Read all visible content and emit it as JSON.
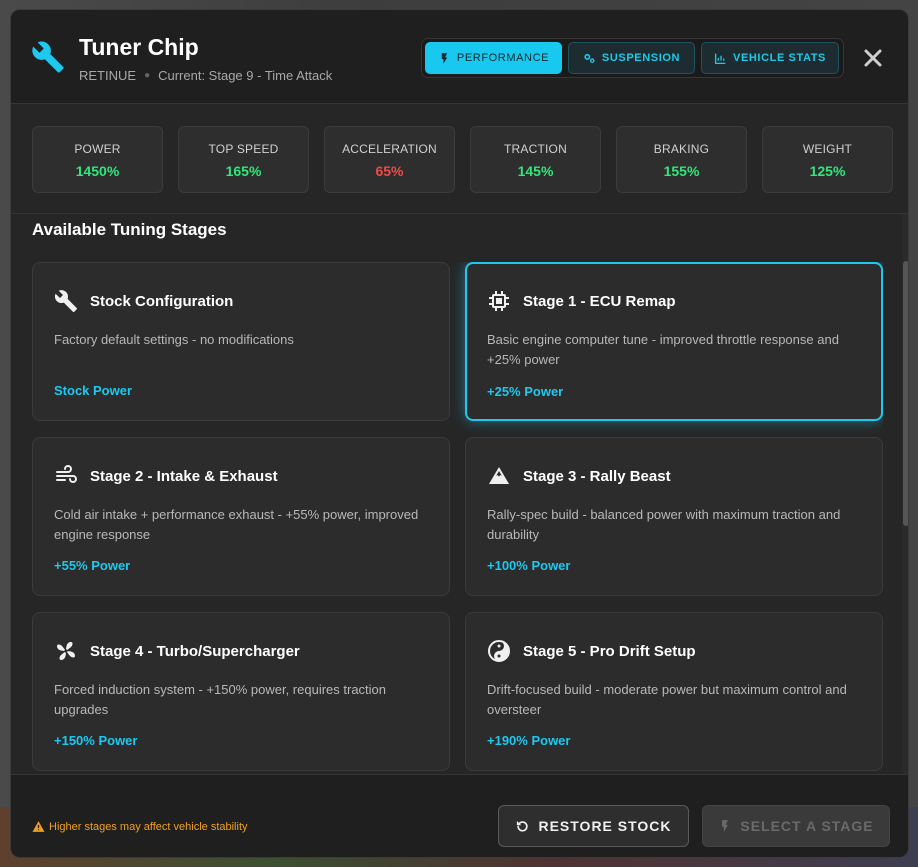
{
  "header": {
    "title": "Tuner Chip",
    "vehicle": "RETINUE",
    "current": "Current: Stage 9 - Time Attack",
    "tabs": [
      {
        "label": "PERFORMANCE",
        "icon": "bolt-icon",
        "active": true
      },
      {
        "label": "SUSPENSION",
        "icon": "gears-icon",
        "active": false
      },
      {
        "label": "VEHICLE STATS",
        "icon": "chart-icon",
        "active": false
      }
    ]
  },
  "stats": [
    {
      "label": "POWER",
      "value": "1450%",
      "status": "good"
    },
    {
      "label": "TOP SPEED",
      "value": "165%",
      "status": "good"
    },
    {
      "label": "ACCELERATION",
      "value": "65%",
      "status": "bad"
    },
    {
      "label": "TRACTION",
      "value": "145%",
      "status": "good"
    },
    {
      "label": "BRAKING",
      "value": "155%",
      "status": "good"
    },
    {
      "label": "WEIGHT",
      "value": "125%",
      "status": "good"
    }
  ],
  "section_title": "Available Tuning Stages",
  "stages": [
    {
      "icon": "wrench-icon",
      "title": "Stock Configuration",
      "desc": "Factory default settings - no modifications",
      "power": "Stock Power"
    },
    {
      "icon": "chip-icon",
      "title": "Stage 1 - ECU Remap",
      "desc": "Basic engine computer tune - improved throttle response and +25% power",
      "power": "+25% Power",
      "selected": true
    },
    {
      "icon": "wind-icon",
      "title": "Stage 2 - Intake & Exhaust",
      "desc": "Cold air intake + performance exhaust - +55% power, improved engine response",
      "power": "+55% Power"
    },
    {
      "icon": "mountain-icon",
      "title": "Stage 3 - Rally Beast",
      "desc": "Rally-spec build - balanced power with maximum traction and durability",
      "power": "+100% Power"
    },
    {
      "icon": "fan-icon",
      "title": "Stage 4 - Turbo/Supercharger",
      "desc": "Forced induction system - +150% power, requires traction upgrades",
      "power": "+150% Power"
    },
    {
      "icon": "yin-yang-icon",
      "title": "Stage 5 - Pro Drift Setup",
      "desc": "Drift-focused build - moderate power but maximum control and oversteer",
      "power": "+190% Power"
    }
  ],
  "footer": {
    "warning": "Higher stages may affect vehicle stability",
    "restore_label": "RESTORE STOCK",
    "select_label": "SELECT A STAGE"
  },
  "colors": {
    "accent": "#1ec8ee",
    "good": "#2ee87a",
    "bad": "#f04a4a",
    "warning": "#f0a020"
  }
}
